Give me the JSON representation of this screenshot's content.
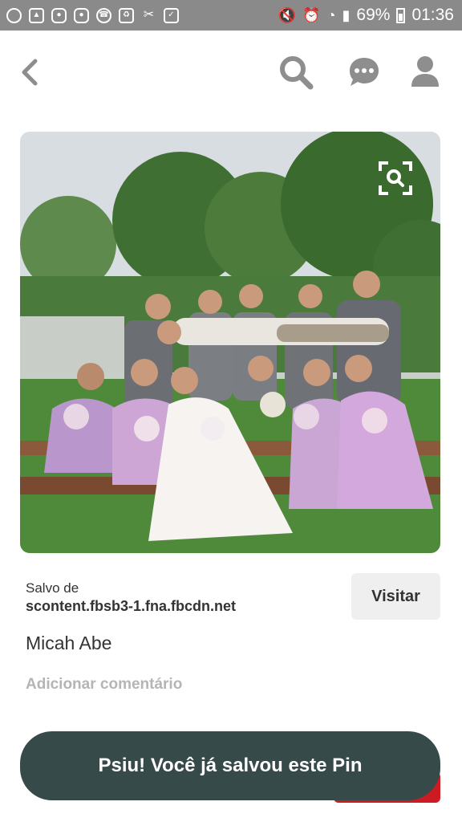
{
  "status_bar": {
    "battery": "69%",
    "time": "01:36"
  },
  "nav": {
    "back_icon": "chevron-left-icon",
    "search_icon": "search-icon",
    "messages_icon": "chat-bubble-icon",
    "profile_icon": "person-icon"
  },
  "pin": {
    "image_alt": "Wedding party photo: bride and bridesmaids in lilac dresses seated on a bench, groomsmen holding the groom horizontally behind them, trees in background",
    "lens_icon": "visual-search-icon"
  },
  "meta": {
    "saved_from_label": "Salvo de",
    "source": "scontent.fbsb3-1.fna.fbcdn.net",
    "visit_label": "Visitar",
    "author": "Micah Abe",
    "comment_placeholder": "Adicionar comentário"
  },
  "toast": {
    "message": "Psiu! Você já salvou este Pin"
  },
  "colors": {
    "status_bar": "#8a8a8a",
    "toast_bg": "#364a4a",
    "save_red": "#cc1b23",
    "icon_gray": "#8e8e8e"
  }
}
